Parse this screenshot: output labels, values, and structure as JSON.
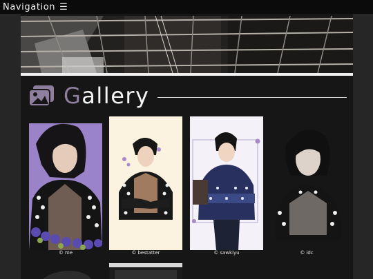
{
  "navbar": {
    "label": "Navigation",
    "menu_icon": "hamburger-icon"
  },
  "banner": {
    "image": "industrial ceiling beams photo"
  },
  "gallery": {
    "icon": "gallery-images-icon",
    "title_first_letter": "G",
    "title_rest": "allery",
    "accent_color": "#8e7f9e",
    "items": [
      {
        "credit_symbol": "©",
        "credit": "me"
      },
      {
        "credit_symbol": "©",
        "credit": "bestatter"
      },
      {
        "credit_symbol": "©",
        "credit": "sawkiyu"
      },
      {
        "credit_symbol": "©",
        "credit": "idc"
      }
    ]
  }
}
